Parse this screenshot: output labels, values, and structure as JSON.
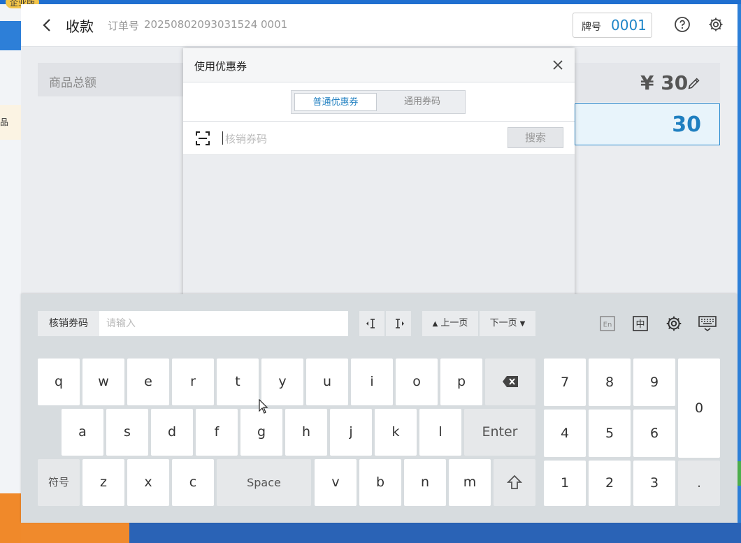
{
  "background": {
    "corner_label": "企业版",
    "left_strip_text": "品"
  },
  "header": {
    "title": "收款",
    "order_label": "订单号",
    "order_number": "20250802093031524 0001",
    "tag_label": "牌号",
    "tag_value": "0001"
  },
  "summary": {
    "goods_total_label": "商品总额",
    "amount": "¥ 30",
    "input_amount": "30"
  },
  "modal": {
    "title": "使用优惠券",
    "tabs": [
      {
        "label": "普通优惠券",
        "active": true
      },
      {
        "label": "通用券码",
        "active": false
      }
    ],
    "search_placeholder": "核销券码",
    "search_button": "搜索"
  },
  "keyboard": {
    "field_label": "核销券码",
    "field_placeholder": "请输入",
    "prev_page": "上一页",
    "next_page": "下一页",
    "row1": [
      "q",
      "w",
      "e",
      "r",
      "t",
      "y",
      "u",
      "i",
      "o",
      "p"
    ],
    "row2": [
      "a",
      "s",
      "d",
      "f",
      "g",
      "h",
      "j",
      "k",
      "l"
    ],
    "row3_left": [
      "z",
      "x",
      "c"
    ],
    "row3_right": [
      "v",
      "b",
      "n",
      "m"
    ],
    "enter": "Enter",
    "space": "Space",
    "symbols": "符号",
    "numpad": [
      "7",
      "8",
      "9",
      "4",
      "5",
      "6",
      "1",
      "2",
      "3"
    ],
    "zero": "0",
    "dot": ".",
    "lang_en": "En",
    "lang_zh": "中"
  },
  "colors": {
    "accent": "#1f7fc0",
    "panel_bg": "#ebedf0",
    "keyboard_bg": "#d7dcdf"
  }
}
